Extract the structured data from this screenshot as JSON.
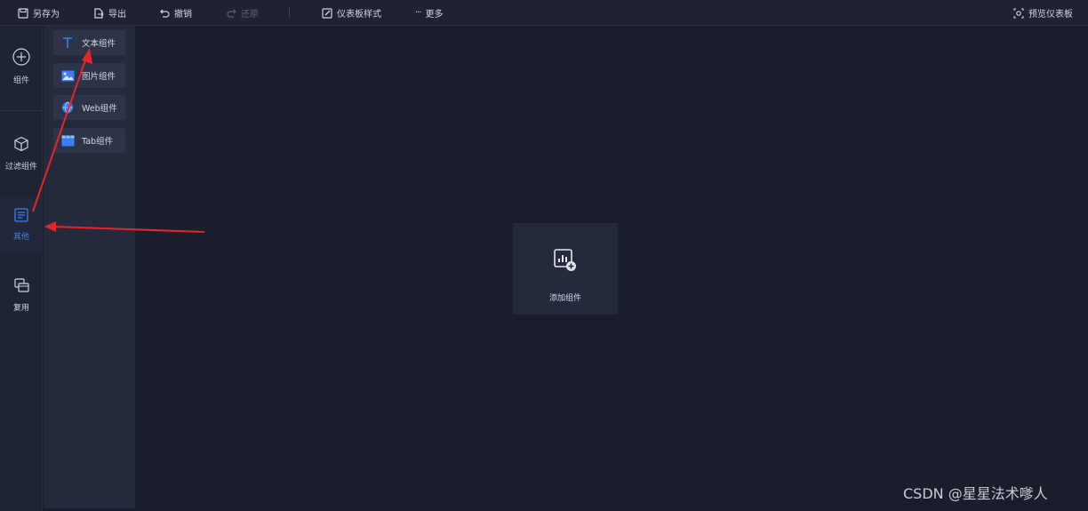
{
  "toolbar": {
    "save_as": "另存为",
    "export": "导出",
    "undo": "撤销",
    "redo": "还原",
    "dashboard_style": "仪表板样式",
    "more": "更多",
    "preview": "预览仪表板"
  },
  "sidebar": {
    "items": [
      {
        "label": "组件",
        "icon": "plus-circle-icon"
      },
      {
        "label": "过滤组件",
        "icon": "cube-icon"
      },
      {
        "label": "其他",
        "icon": "document-icon",
        "active": true
      },
      {
        "label": "复用",
        "icon": "copy-windows-icon"
      }
    ]
  },
  "components": [
    {
      "label": "文本组件",
      "icon": "text-t-icon"
    },
    {
      "label": "图片组件",
      "icon": "image-icon"
    },
    {
      "label": "Web组件",
      "icon": "globe-icon"
    },
    {
      "label": "Tab组件",
      "icon": "tab-icon"
    }
  ],
  "canvas": {
    "add_component": "添加组件"
  },
  "watermark": "CSDN @星星法术嗲人",
  "colors": {
    "accent": "#3b7ff5",
    "annotation": "#e8242b"
  }
}
